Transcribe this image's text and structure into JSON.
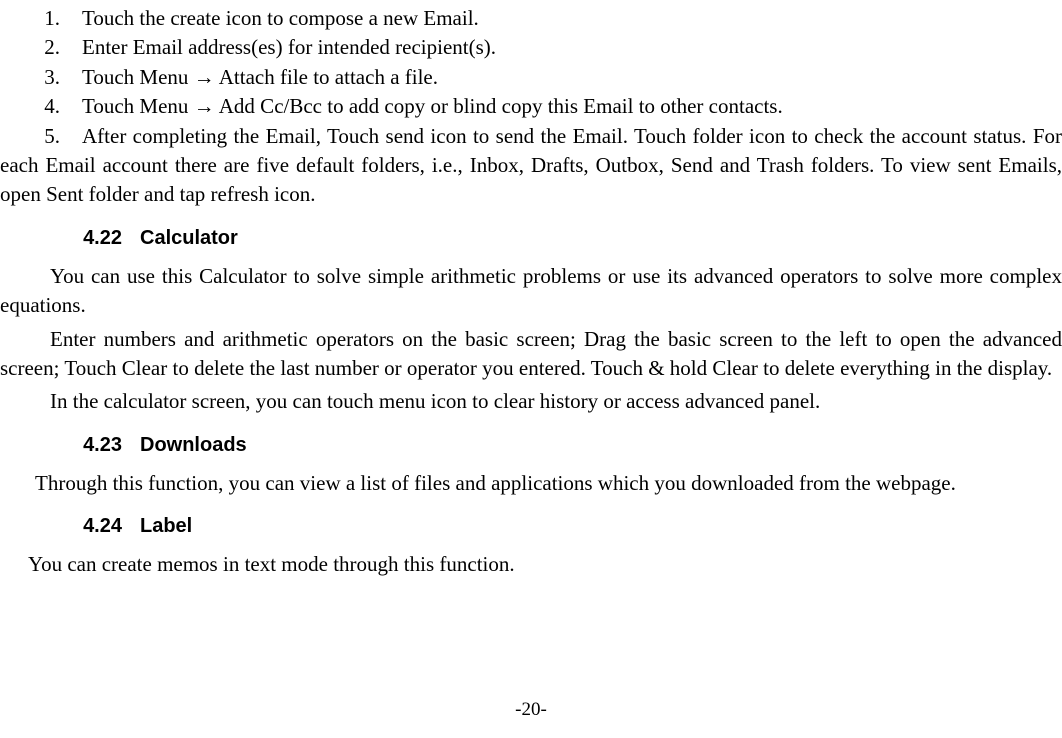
{
  "list": {
    "n1": "1.",
    "n2": "2.",
    "n3": "3.",
    "n4": "4.",
    "n5": "5.",
    "i1": "Touch the create icon to compose a new Email.",
    "i2": "Enter Email address(es) for intended recipient(s).",
    "i3": "Touch Menu  →  Attach file to attach a file.",
    "i4": "Touch Menu  →  Add Cc/Bcc to add copy or blind copy this Email to other contacts.",
    "i5": "After completing the Email, Touch send icon to send the Email. Touch folder icon to check the account status. For each Email account there are five default folders, i.e., Inbox, Drafts, Outbox, Send and Trash folders. To view sent Emails, open Sent folder and tap refresh icon."
  },
  "sections": {
    "s1": {
      "num": "4.22",
      "title": "Calculator"
    },
    "s2": {
      "num": "4.23",
      "title": "Downloads"
    },
    "s3": {
      "num": "4.24",
      "title": "Label"
    }
  },
  "paras": {
    "calc1": "You can use this Calculator to solve simple arithmetic problems or use its advanced operators to solve more complex equations.",
    "calc2": "Enter numbers and arithmetic operators on the basic screen; Drag the basic screen to the left to open the advanced screen; Touch Clear to delete the last number or operator you entered. Touch & hold Clear to delete everything in the display.",
    "calc3": "In the calculator screen, you can touch menu icon to clear history or access advanced panel.",
    "dl": "Through this function, you can view a list of files and applications which you downloaded from the webpage.",
    "label": "You can create memos in text mode through this function."
  },
  "pagenum": "-20-"
}
